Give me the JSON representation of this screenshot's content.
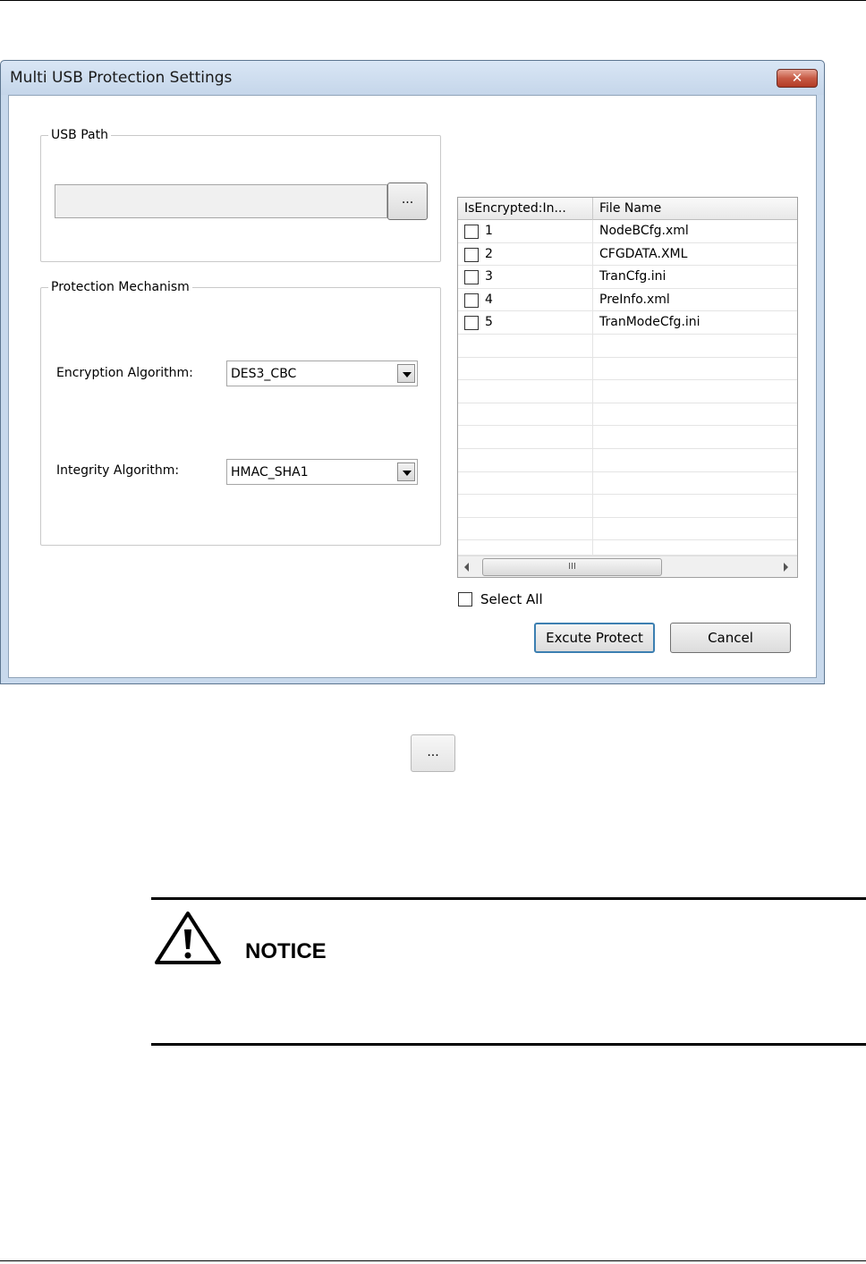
{
  "window": {
    "title": "Multi USB Protection Settings",
    "close_glyph": "✕"
  },
  "usb_path": {
    "group_label": "USB Path",
    "path_value": "",
    "browse_label": "..."
  },
  "protection": {
    "group_label": "Protection Mechanism",
    "encryption_label": "Encryption Algorithm:",
    "encryption_value": "DES3_CBC",
    "integrity_label": "Integrity Algorithm:",
    "integrity_value": "HMAC_SHA1"
  },
  "file_grid": {
    "columns": [
      "IsEncrypted:In...",
      "File Name"
    ],
    "rows": [
      {
        "index": "1",
        "file": "NodeBCfg.xml",
        "checked": false
      },
      {
        "index": "2",
        "file": "CFGDATA.XML",
        "checked": false
      },
      {
        "index": "3",
        "file": "TranCfg.ini",
        "checked": false
      },
      {
        "index": "4",
        "file": "PreInfo.xml",
        "checked": false
      },
      {
        "index": "5",
        "file": "TranModeCfg.ini",
        "checked": false
      }
    ],
    "scroll_thumb_glyph": "III"
  },
  "select_all": {
    "label": "Select All",
    "checked": false
  },
  "buttons": {
    "execute_label": "Excute Protect",
    "cancel_label": "Cancel"
  },
  "doc": {
    "browse_icon_label": "...",
    "notice_label": "NOTICE"
  },
  "colors": {
    "window_frame": "#c8d9ec",
    "close_button": "#c75a45",
    "default_button_border": "#3c7fb1"
  }
}
